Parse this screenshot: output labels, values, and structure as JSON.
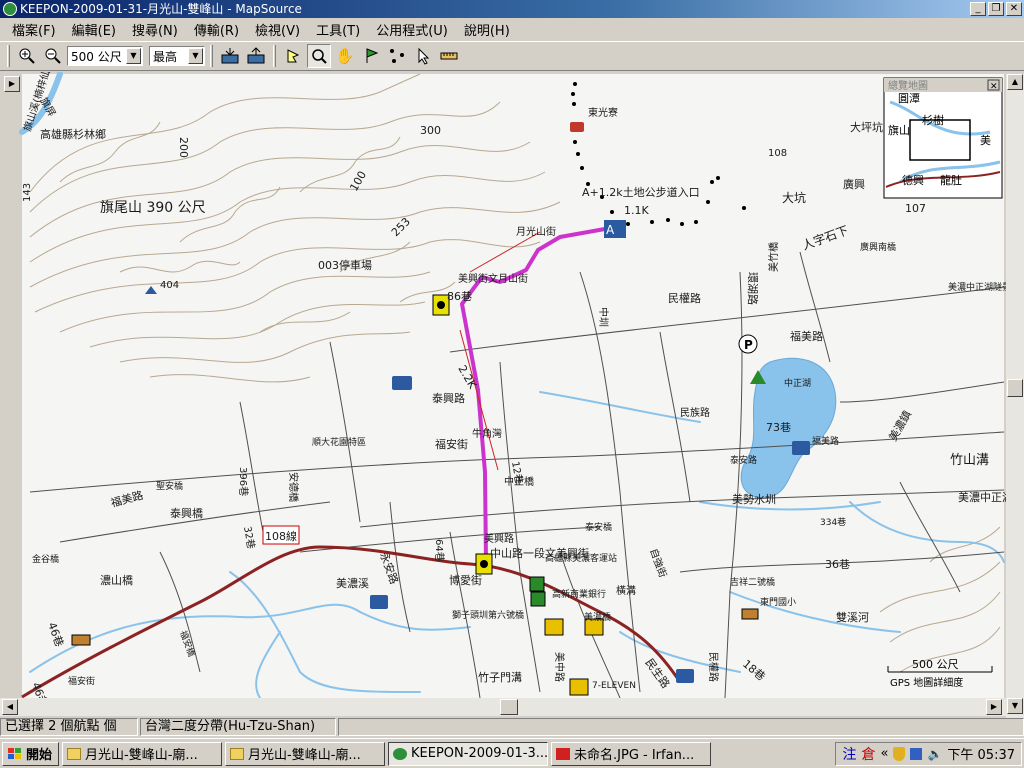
{
  "window": {
    "title": "KEEPON-2009-01-31-月光山-雙峰山 - MapSource",
    "min": "_",
    "max": "❐",
    "close": "✕"
  },
  "menu": [
    "檔案(F)",
    "編輯(E)",
    "搜尋(N)",
    "傳輸(R)",
    "檢視(V)",
    "工具(T)",
    "公用程式(U)",
    "說明(H)"
  ],
  "toolbar": {
    "zoom_value": "500 公尺",
    "detail_value": "最高",
    "buttons": [
      "zoom-in-icon",
      "zoom-out-icon",
      "receive-from-device-icon",
      "send-to-device-icon",
      "select-tool-icon",
      "zoom-tool-icon",
      "hand-tool-icon",
      "waypoint-flag-icon",
      "route-tool-icon",
      "pointer-icon",
      "measure-tool-icon"
    ]
  },
  "map": {
    "background": "#f5f5f3",
    "water_color": "#89c2ea",
    "route_color": "#cc33cc",
    "track_color": "#000000",
    "labels": [
      {
        "text": "旗山溪(楠梓仙溪)"
      },
      {
        "text": "高雄縣杉林鄉"
      },
      {
        "text": "旗尾山 390 公尺"
      },
      {
        "text": "404"
      },
      {
        "text": "300"
      },
      {
        "text": "200"
      },
      {
        "text": "100"
      },
      {
        "text": "253"
      },
      {
        "text": "003停車場"
      },
      {
        "text": "東光寮"
      },
      {
        "text": "A+1.2k土地公步道入口"
      },
      {
        "text": "1.1K"
      },
      {
        "text": "月光山街"
      },
      {
        "text": "美興街文月山街"
      },
      {
        "text": "86巷"
      },
      {
        "text": "中圳"
      },
      {
        "text": "民權路"
      },
      {
        "text": "環湖路"
      },
      {
        "text": "福美路"
      },
      {
        "text": "人字石下"
      },
      {
        "text": "大坑"
      },
      {
        "text": "大坪坑"
      },
      {
        "text": "廣興"
      },
      {
        "text": "107"
      },
      {
        "text": "108"
      },
      {
        "text": "美竹橋"
      },
      {
        "text": "廣興南橋"
      },
      {
        "text": "美濃中正湖隧景風景區"
      },
      {
        "text": "中正湖"
      },
      {
        "text": "73巷"
      },
      {
        "text": "民族路"
      },
      {
        "text": "美濃鎮"
      },
      {
        "text": "竹山溝"
      },
      {
        "text": "美濃中正湖隧景風景區"
      },
      {
        "text": "福美路"
      },
      {
        "text": "泰興路"
      },
      {
        "text": "2.2K"
      },
      {
        "text": "牛角灣"
      },
      {
        "text": "福安街"
      },
      {
        "text": "順大花園特區"
      },
      {
        "text": "中正橋"
      },
      {
        "text": "泰安路"
      },
      {
        "text": "美勢水圳"
      },
      {
        "text": "334巷"
      },
      {
        "text": "396巷"
      },
      {
        "text": "安德橋"
      },
      {
        "text": "福美路"
      },
      {
        "text": "泰興橋"
      },
      {
        "text": "聖安橋"
      },
      {
        "text": "32巷"
      },
      {
        "text": "108線"
      },
      {
        "text": "永安路"
      },
      {
        "text": "美濃溪"
      },
      {
        "text": "中山路一段文美興街"
      },
      {
        "text": "博愛街"
      },
      {
        "text": "高雄縣美濃客運站"
      },
      {
        "text": "泰安橋"
      },
      {
        "text": "高新商業銀行"
      },
      {
        "text": "橫溝"
      },
      {
        "text": "自強街"
      },
      {
        "text": "36巷"
      },
      {
        "text": "吉祥二號橋"
      },
      {
        "text": "東門國小"
      },
      {
        "text": "民生路"
      },
      {
        "text": "民權路"
      },
      {
        "text": "雙溪河"
      },
      {
        "text": "18巷"
      },
      {
        "text": "濃山橋"
      },
      {
        "text": "46巷"
      },
      {
        "text": "46巷"
      },
      {
        "text": "福安街"
      },
      {
        "text": "金谷橋"
      },
      {
        "text": "福安橋"
      },
      {
        "text": "竹子門溝"
      },
      {
        "text": "7-ELEVEN"
      },
      {
        "text": "美中路"
      },
      {
        "text": "獅子頭圳第六號橋"
      },
      {
        "text": "64巷"
      },
      {
        "text": "12巷"
      },
      {
        "text": "美興路"
      },
      {
        "text": "美濃橋"
      },
      {
        "text": "143"
      },
      {
        "text": "旗屏"
      }
    ],
    "scale_label": "500 公尺",
    "detail_note": "GPS 地圖詳細度",
    "overview_title": "總覽地圖",
    "overview_labels": [
      "圓潭",
      "旗山",
      "美",
      "德興",
      "龍肚",
      "杉樹"
    ]
  },
  "status": {
    "selection": "已選擇 2 個航點 個",
    "datum": "台灣二度分帶(Hu-Tzu-Shan)"
  },
  "taskbar": {
    "start": "開始",
    "tasks": [
      "月光山-雙峰山-廟...",
      "月光山-雙峰山-廟...",
      "KEEPON-2009-01-3...",
      "未命名.JPG - Irfan..."
    ],
    "ime1": "注",
    "ime2": "倉",
    "clock": "下午 05:37"
  }
}
